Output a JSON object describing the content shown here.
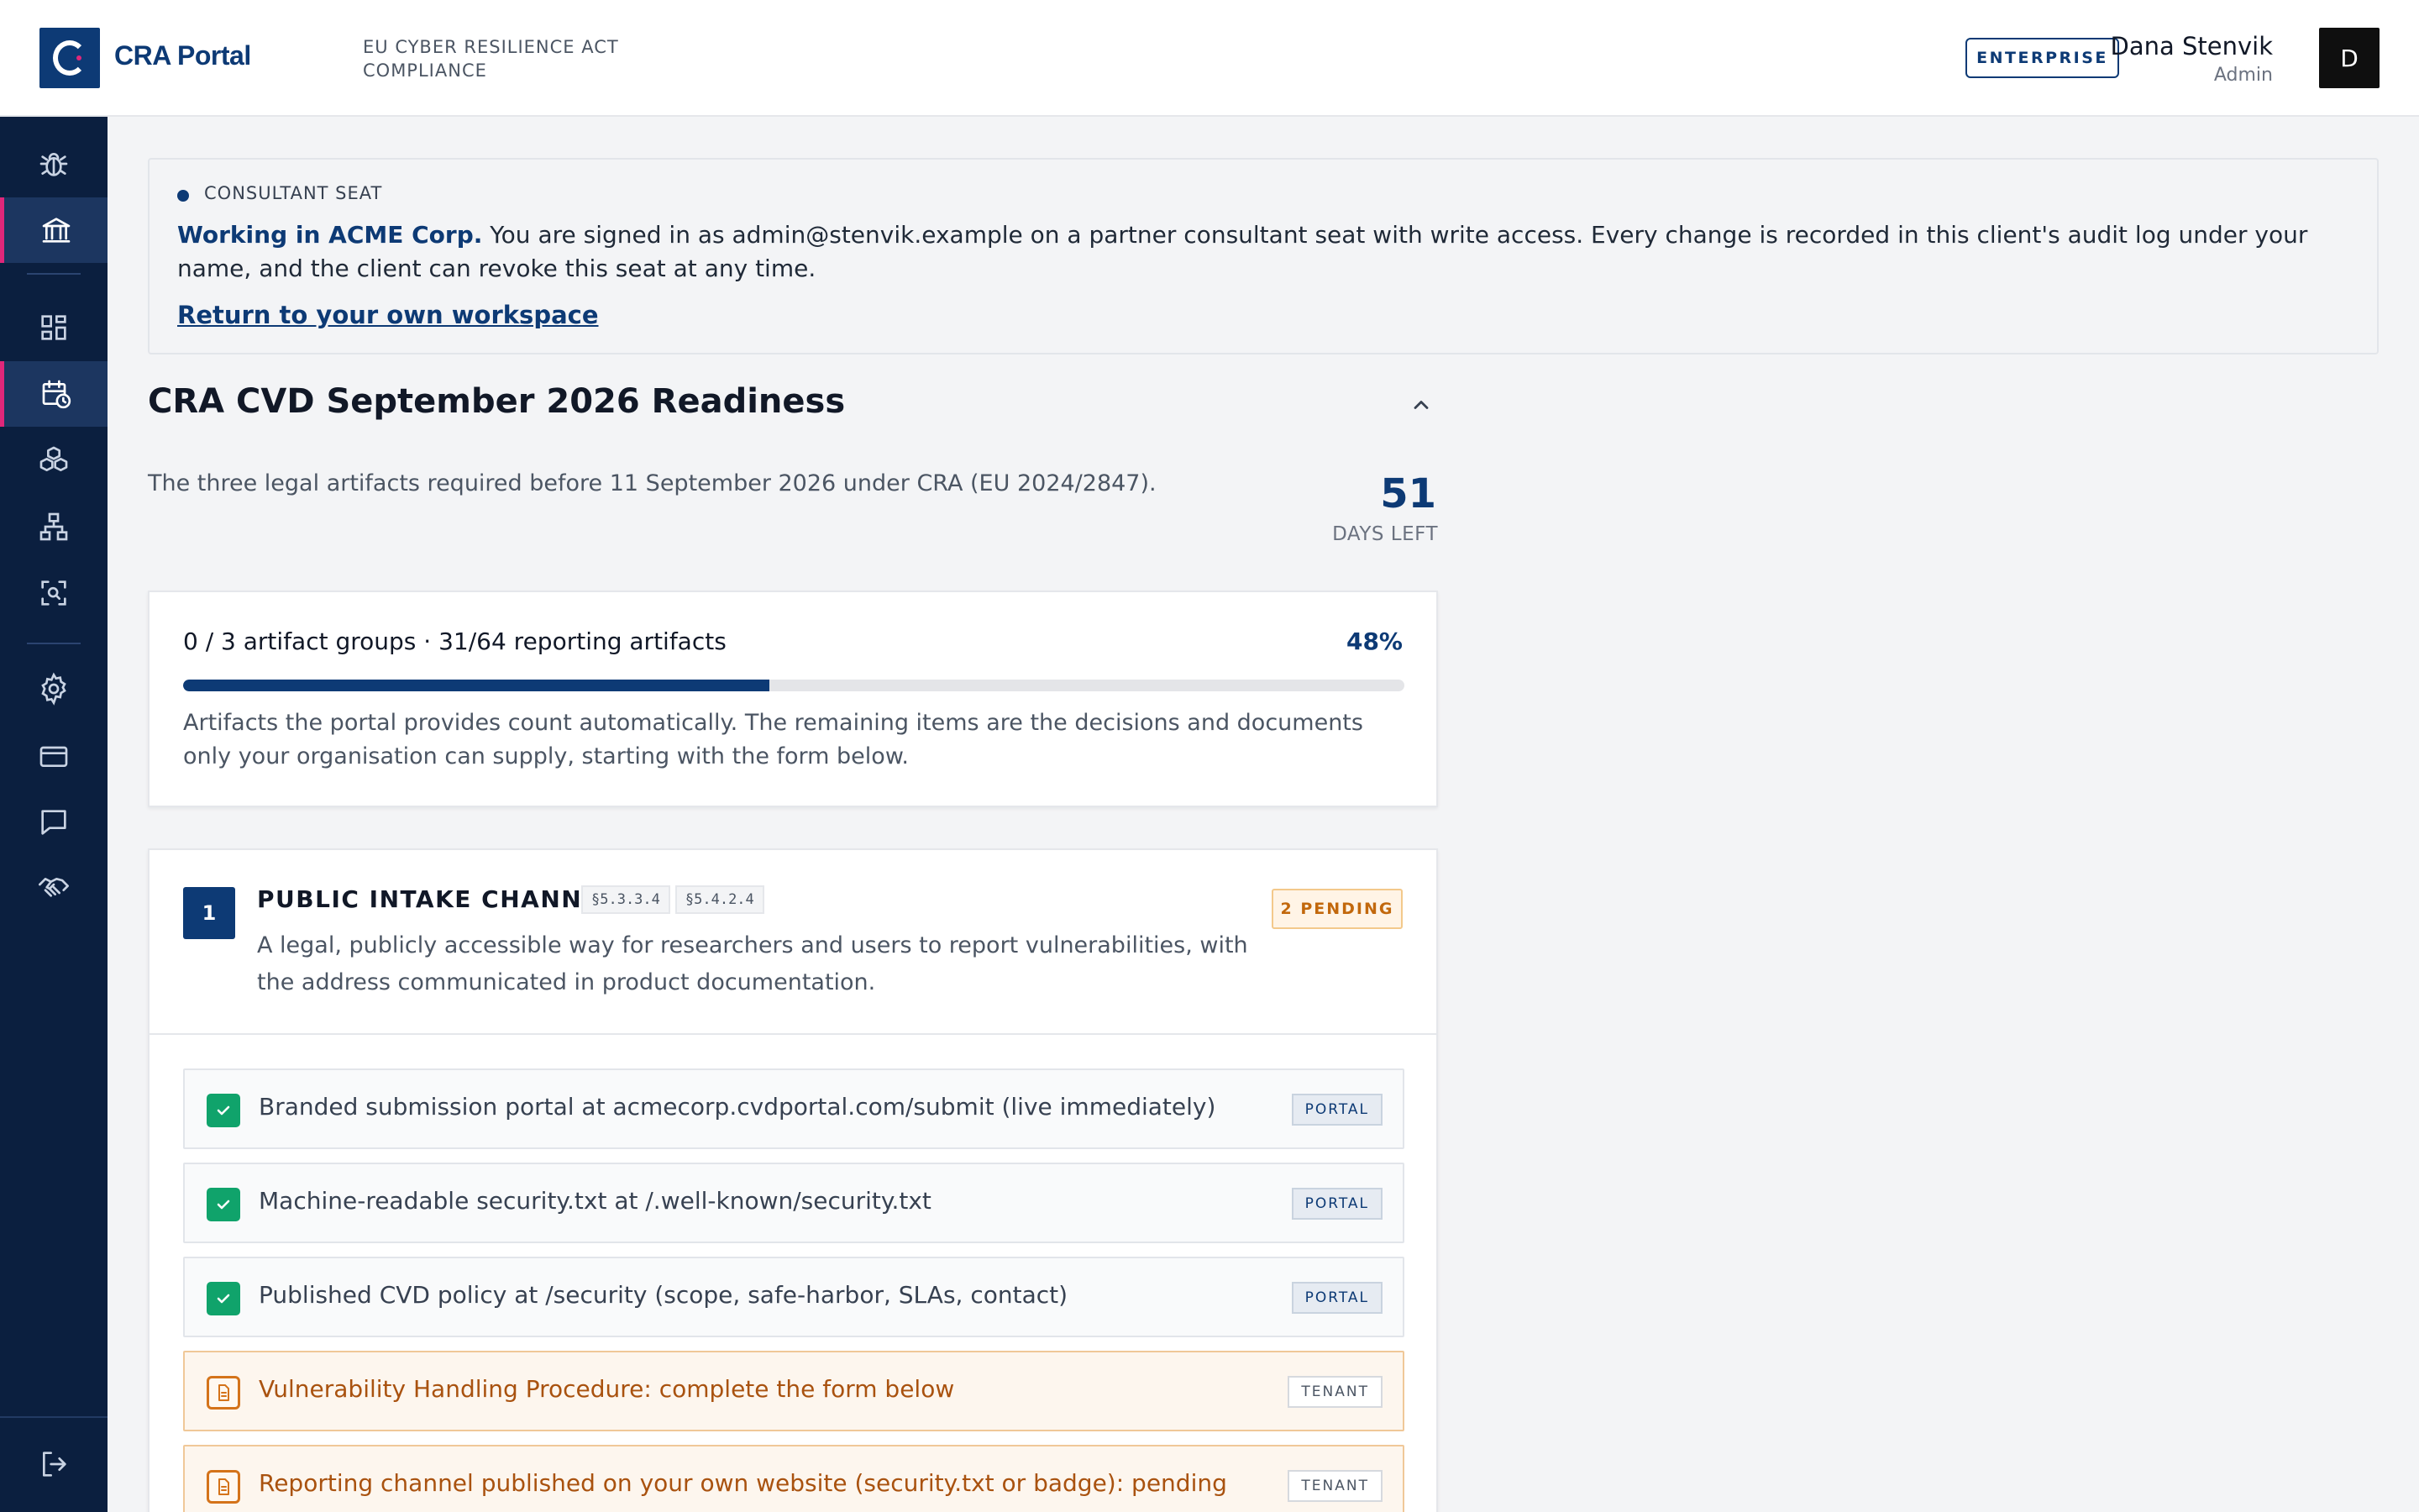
{
  "header": {
    "brand_name": "CRA Portal",
    "brand_subtitle": "EU CYBER RESILIENCE ACT COMPLIANCE",
    "plan_badge": "ENTERPRISE",
    "user_name": "Dana Stenvik",
    "user_role": "Admin",
    "avatar_initial": "D"
  },
  "sidebar": {
    "items": [
      {
        "icon": "bug-icon",
        "active": false
      },
      {
        "icon": "bank-icon",
        "active": true
      },
      {
        "icon": "dashboard-grid-icon",
        "active": false
      },
      {
        "icon": "calendar-clock-icon",
        "active": true
      },
      {
        "icon": "cubes-icon",
        "active": false
      },
      {
        "icon": "hierarchy-icon",
        "active": false
      },
      {
        "icon": "scan-search-icon",
        "active": false
      },
      {
        "icon": "gear-icon",
        "active": false
      },
      {
        "icon": "credit-card-icon",
        "active": false
      },
      {
        "icon": "chat-icon",
        "active": false
      },
      {
        "icon": "handshake-icon",
        "active": false
      },
      {
        "icon": "logout-icon",
        "active": false
      }
    ]
  },
  "banner": {
    "kicker": "CONSULTANT SEAT",
    "lead": "Working in ACME Corp.",
    "body": " You are signed in as admin@stenvik.example on a partner consultant seat with write access. Every change is recorded in this client's audit log under your name, and the client can revoke this seat at any time.",
    "link": "Return to your own workspace"
  },
  "readiness": {
    "title": "CRA CVD September 2026 Readiness",
    "description": "The three legal artifacts required before 11 September 2026 under CRA (EU 2024/2847).",
    "days_left": "51",
    "days_left_label": "DAYS LEFT",
    "summary": "0 / 3 artifact groups · 31/64 reporting artifacts",
    "percent_label": "48%",
    "percent": 48,
    "note": "Artifacts the portal provides count automatically. The remaining items are the decisions and documents only your organisation can supply, starting with the form below."
  },
  "group": {
    "number": "1",
    "title": "PUBLIC INTAKE CHANNEL",
    "refs": [
      "§5.3.3.4",
      "§5.4.2.4"
    ],
    "pending": "2 PENDING",
    "description": "A legal, publicly accessible way for researchers and users to report vulnerabilities, with the address communicated in product documentation.",
    "items": [
      {
        "label": "Branded submission portal at acmecorp.cvdportal.com/submit (live immediately)",
        "source": "PORTAL",
        "done": true
      },
      {
        "label": "Machine-readable security.txt at /.well-known/security.txt",
        "source": "PORTAL",
        "done": true
      },
      {
        "label": "Published CVD policy at /security (scope, safe-harbor, SLAs, contact)",
        "source": "PORTAL",
        "done": true
      },
      {
        "label": "Vulnerability Handling Procedure: complete the form below",
        "source": "TENANT",
        "done": false
      },
      {
        "label": "Reporting channel published on your own website (security.txt or badge): pending",
        "source": "TENANT",
        "done": false
      }
    ]
  },
  "colors": {
    "brand": "#0d3a75",
    "accent": "#e0277a",
    "success": "#10a36b",
    "warning": "#c2680c",
    "sidebar_bg": "#0b1f3f"
  }
}
